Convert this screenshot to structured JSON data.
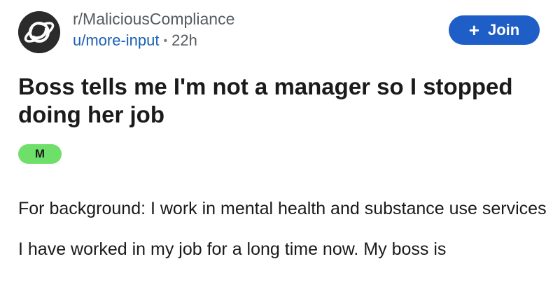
{
  "header": {
    "subreddit": "r/MaliciousCompliance",
    "username": "u/more-input",
    "separator": "•",
    "age": "22h",
    "avatar_icon": "planet-icon"
  },
  "join": {
    "icon": "plus-icon",
    "plus_glyph": "+",
    "label": "Join",
    "color": "#1f5ec7"
  },
  "post": {
    "title": "Boss tells me I'm not a manager so I stopped doing her job",
    "flair": "M",
    "flair_color": "#6ee06a",
    "paragraphs": [
      "For background: I work in mental health and substance use services",
      "I have worked in my job for a long time now. My boss is"
    ]
  }
}
